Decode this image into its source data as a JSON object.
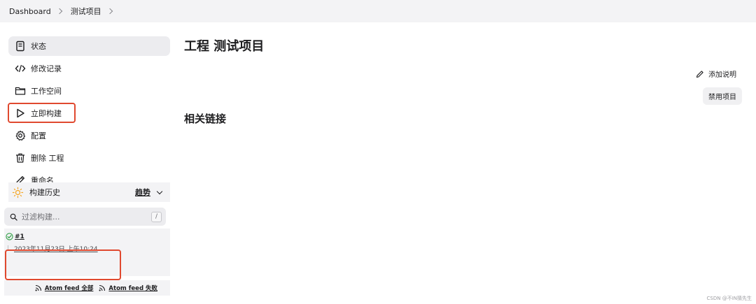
{
  "breadcrumb": {
    "items": [
      "Dashboard",
      "测试项目"
    ]
  },
  "sidebar": {
    "items": [
      {
        "label": "状态",
        "icon": "document-icon"
      },
      {
        "label": "修改记录",
        "icon": "code-icon"
      },
      {
        "label": "工作空间",
        "icon": "folder-icon"
      },
      {
        "label": "立即构建",
        "icon": "play-icon"
      },
      {
        "label": "配置",
        "icon": "gear-icon"
      },
      {
        "label": "删除 工程",
        "icon": "trash-icon"
      },
      {
        "label": "重命名",
        "icon": "pencil-icon"
      }
    ]
  },
  "build_history": {
    "title": "构建历史",
    "trend_label": "趋势",
    "filter_placeholder": "过滤构建...",
    "filter_shortcut": "/",
    "builds": [
      {
        "number": "#1",
        "date": "2023年11月23日 上午10:24",
        "status": "success"
      }
    ],
    "feeds": {
      "all": "Atom feed 全部",
      "failed": "Atom feed 失败"
    }
  },
  "main": {
    "title": "工程 测试项目",
    "section_title": "相关链接",
    "add_description": "添加说明",
    "disable_project": "禁用项目"
  },
  "watermark": "CSDN @不IN猜先生",
  "colors": {
    "highlight": "#e0492f",
    "success": "#2f9e44",
    "sun": "#f5a623"
  }
}
